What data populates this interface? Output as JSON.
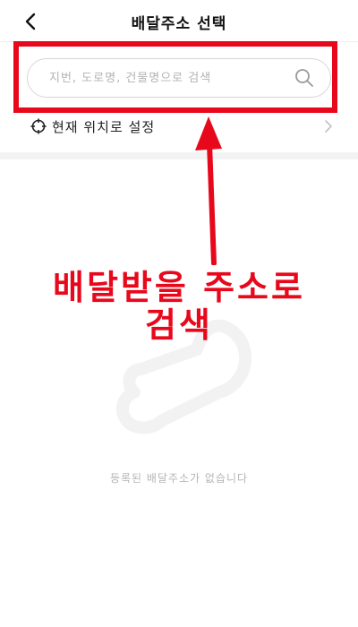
{
  "header": {
    "title": "배달주소 선택",
    "back_icon": "chevron-left-icon"
  },
  "search": {
    "placeholder": "지번, 도로명, 건물명으로 검색",
    "icon": "search-icon"
  },
  "location": {
    "label": "현재 위치로 설정",
    "icon": "crosshair-icon",
    "chevron_icon": "chevron-right-icon"
  },
  "annotation": {
    "line1": "배달받을 주소로",
    "line2": "검색",
    "color": "#e8081c"
  },
  "empty_state": {
    "message": "등록된 배달주소가 없습니다",
    "icon": "drumstick-icon"
  }
}
